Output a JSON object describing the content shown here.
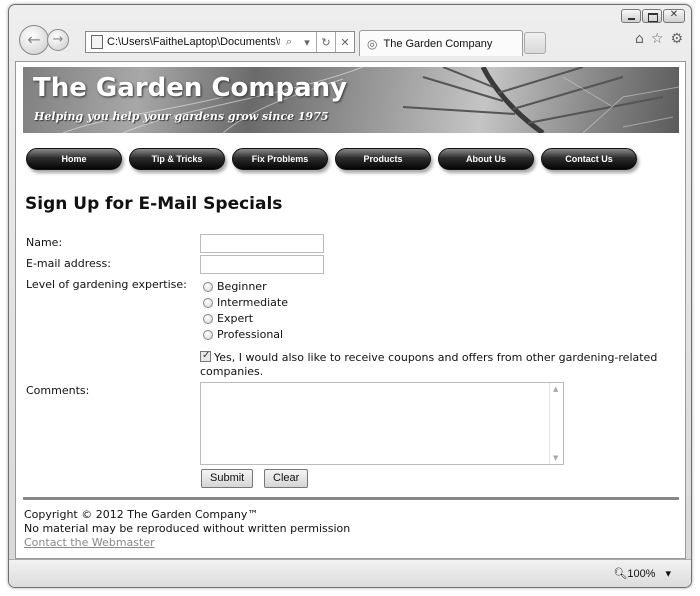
{
  "browser": {
    "address": "C:\\Users\\FaitheLaptop\\Documents\\t",
    "tab_title": "The Garden Company",
    "zoom": "100%"
  },
  "banner": {
    "title": "The Garden Company",
    "tagline": "Helping you help your gardens grow since 1975"
  },
  "nav": [
    {
      "label": "Home"
    },
    {
      "label": "Tip & Tricks"
    },
    {
      "label": "Fix Problems"
    },
    {
      "label": "Products"
    },
    {
      "label": "About Us"
    },
    {
      "label": "Contact Us"
    }
  ],
  "form": {
    "heading": "Sign Up for E-Mail Specials",
    "name_label": "Name:",
    "email_label": "E-mail address:",
    "expertise_label": "Level of gardening expertise:",
    "expertise_options": [
      "Beginner",
      "Intermediate",
      "Expert",
      "Professional"
    ],
    "opt_in_text": "Yes, I would also like to receive coupons and offers from other gardening-related companies.",
    "opt_in_checked": true,
    "comments_label": "Comments:",
    "submit_label": "Submit",
    "clear_label": "Clear"
  },
  "footer": {
    "copyright": "Copyright © 2012 The Garden Company™",
    "notice": "No material may be reproduced without written permission",
    "webmaster_link": "Contact the Webmaster"
  }
}
